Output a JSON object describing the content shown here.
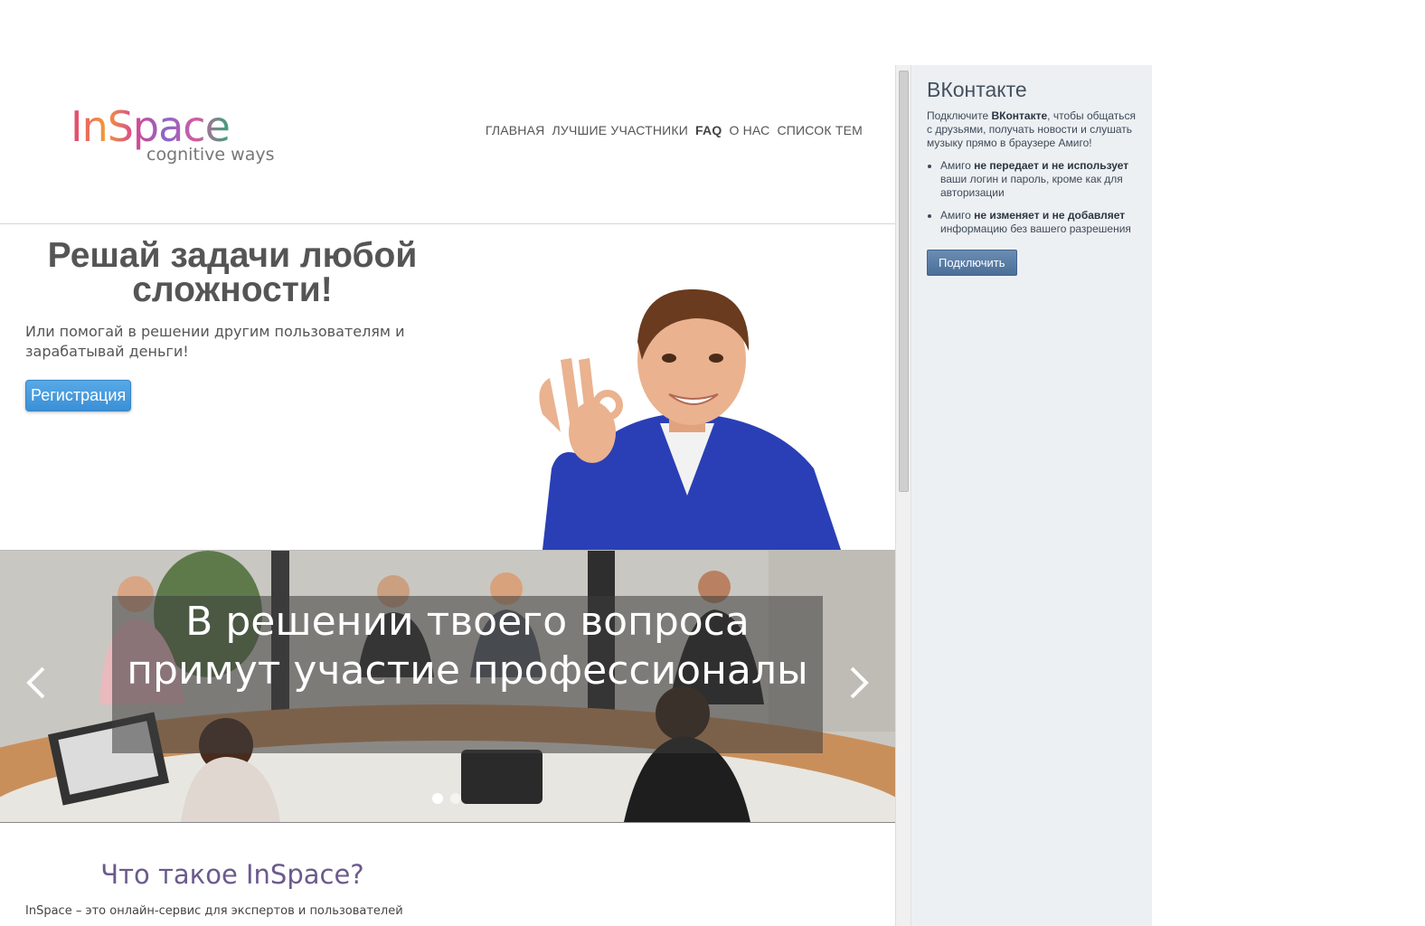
{
  "site": {
    "logo": {
      "brand": "InSpace",
      "tagline": "cognitive ways"
    },
    "nav": [
      {
        "label": "ГЛАВНАЯ",
        "bold": false
      },
      {
        "label": "ЛУЧШИЕ УЧАСТНИКИ",
        "bold": false
      },
      {
        "label": "FAQ",
        "bold": true
      },
      {
        "label": "О НАС",
        "bold": false
      },
      {
        "label": "СПИСОК ТЕМ",
        "bold": false
      }
    ],
    "hero": {
      "title": "Решай задачи любой сложности!",
      "subtitle": "Или помогай в решении другим пользователям и зарабатывай деньги!",
      "register_label": "Регистрация"
    },
    "carousel": {
      "caption": "В решении твоего вопроса примут участие профессионалы",
      "slide_count": 2,
      "active_slide": 1
    },
    "about": {
      "title": "Что такое InSpace?",
      "text": "InSpace – это онлайн-сервис для экспертов и пользователей"
    }
  },
  "vk": {
    "title": "ВКонтакте",
    "intro": {
      "before": "Подключите ",
      "strong": "ВКонтакте",
      "after": ", чтобы общаться с друзьями, получать новости и слушать музыку прямо в браузере Амиго!"
    },
    "bullets": [
      {
        "before": "Амиго ",
        "strong": "не передает и не использует",
        "after": " ваши логин и пароль, кроме как для авторизации"
      },
      {
        "before": "Амиго ",
        "strong": "не изменяет и не добавляет",
        "after": " информацию без вашего разрешения"
      }
    ],
    "connect_label": "Подключить"
  },
  "colors": {
    "vk_bg": "#edf0f3",
    "vk_button": "#4b6f99",
    "register_button": "#3b8fd6",
    "about_title": "#6b5a8c"
  }
}
